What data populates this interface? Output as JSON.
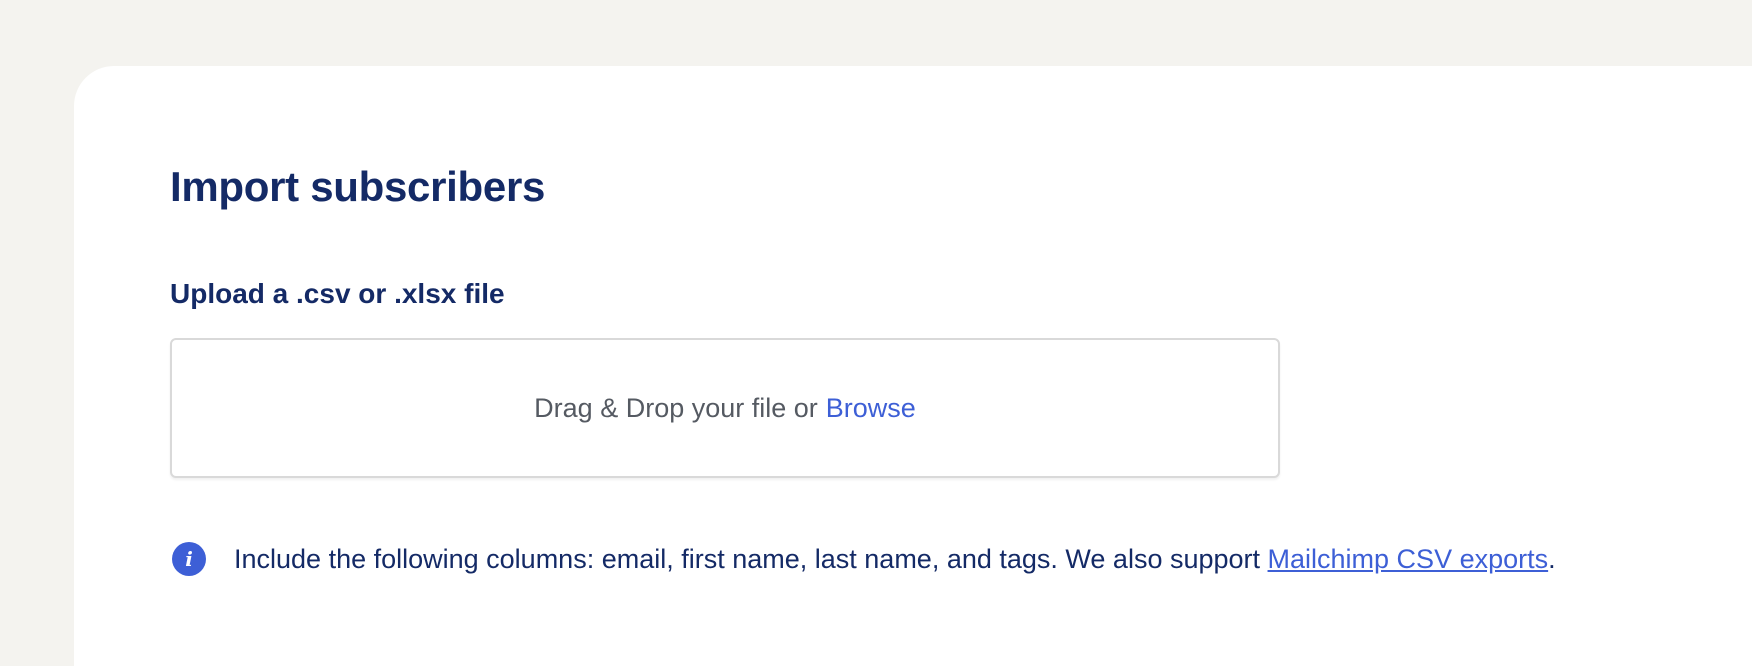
{
  "page": {
    "title": "Import subscribers"
  },
  "upload": {
    "label": "Upload a .csv or .xlsx file",
    "dropzone_text": "Drag & Drop your file or",
    "browse_label": "Browse"
  },
  "info": {
    "icon": "info-icon",
    "text": "Include the following columns: email, first name, last name, and tags. We also support",
    "link_label": "Mailchimp CSV exports",
    "suffix": "."
  },
  "colors": {
    "background": "#f4f3ef",
    "card": "#ffffff",
    "heading": "#142a66",
    "accent": "#3d5fd6",
    "muted_text": "#555a62"
  }
}
